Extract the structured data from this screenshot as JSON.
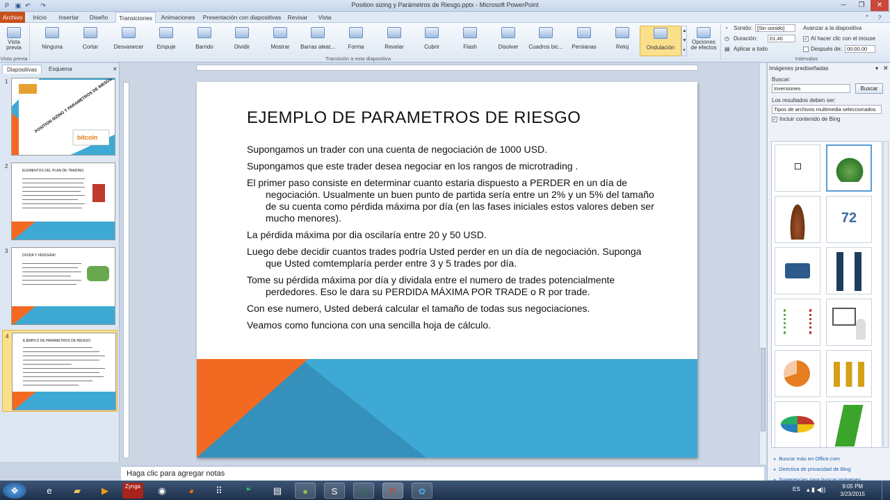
{
  "window": {
    "title": "Position sizing y Parámetros de Riesgo.pptx - Microsoft PowerPoint"
  },
  "tabs": [
    "Archivo",
    "Inicio",
    "Insertar",
    "Diseño",
    "Transiciones",
    "Animaciones",
    "Presentación con diapositivas",
    "Revisar",
    "Vista"
  ],
  "ribbon": {
    "preview_label": "Vista previa",
    "preview_group": "Vista previa",
    "transitions": [
      "Ninguna",
      "Cortar",
      "Desvanecer",
      "Empuje",
      "Barrido",
      "Dividir",
      "Mostrar",
      "Barras aleat...",
      "Forma",
      "Revelar",
      "Cubrir",
      "Flash",
      "Disolver",
      "Cuadros bic...",
      "Persianas",
      "Reloj",
      "Ondulación"
    ],
    "transitions_group": "Transición a esta diapositiva",
    "effect_options": "Opciones de efectos",
    "sound_label": "Sonido:",
    "sound_value": "[Sin sonido]",
    "duration_label": "Duración:",
    "duration_value": "01.40",
    "apply_all": "Aplicar a todo",
    "advance_label": "Avanzar a la diapositiva",
    "on_click": "Al hacer clic con el mouse",
    "after_label": "Después de:",
    "after_value": "00:00.00",
    "timing_group": "Intervalos"
  },
  "panes": {
    "tab_slides": "Diapositivas",
    "tab_outline": "Esquema"
  },
  "thumbnails": [
    {
      "num": "1",
      "title": "POSITION SIZING Y PARAMETROS DE RIESGO",
      "badge": "bitcoin"
    },
    {
      "num": "2",
      "title": "ELEMENTOS DEL PLAN DE TRADING"
    },
    {
      "num": "3",
      "title": "DIVIDA Y VENCERA!"
    },
    {
      "num": "4",
      "title": "EJEMPLO DE PARAMETROS DE RIESGO"
    }
  ],
  "slide": {
    "title": "EJEMPLO DE PARAMETROS DE RIESGO",
    "paragraphs": [
      "Supongamos un trader con una cuenta de negociación de 1000 USD.",
      "Supongamos que este trader desea negociar en los rangos de microtrading .",
      "El primer paso consiste en determinar cuanto estaria dispuesto a PERDER en un día de negociación. Usualmente un buen punto de partida sería entre un 2% y un 5% del tamaño de su cuenta como pérdida máxima por día (en las fases iniciales estos valores deben ser mucho menores).",
      "La pérdida máxima por dia oscilaría entre 20 y 50 USD.",
      "Luego debe decidir cuantos trades podría Usted perder en un día de negociación. Suponga que Usted comtemplaría perder entre 3 y 5 trades por día.",
      "Tome su pérdida máxima por día y dividala entre el numero de trades potencialmente perdedores. Eso le dara su PERDIDA MÁXIMA POR TRADE o R por trade.",
      "Con ese numero, Usted deberá calcular el tamaño de todas sus negociaciones.",
      "Veamos como funciona con una sencilla hoja de cálculo."
    ],
    "colors": {
      "orange": "#f26a21",
      "blue": "#3fa9d5",
      "dark_blue": "#2e7ea6"
    }
  },
  "notes_placeholder": "Haga clic para agregar notas",
  "clipart": {
    "title": "Imágenes prediseñadas",
    "search_label": "Buscar:",
    "search_value": "Inversiones",
    "search_button": "Buscar",
    "results_label": "Los resultados deben ser:",
    "results_value": "Tipos de archivos multimedia seleccionados",
    "include_bing": "Incluir contenido de Bing",
    "items": [
      {
        "label": ""
      },
      {
        "label": ""
      },
      {
        "label": ""
      },
      {
        "label": "72"
      },
      {
        "label": ""
      },
      {
        "label": ""
      },
      {
        "label": ""
      },
      {
        "label": ""
      },
      {
        "label": ""
      },
      {
        "label": ""
      },
      {
        "label": ""
      },
      {
        "label": ""
      }
    ],
    "links": [
      "Buscar más en Office.com",
      "Directiva de privacidad de Bing",
      "Sugerencias para buscar imágenes"
    ]
  },
  "taskbar": {
    "lang": "ES",
    "time": "9:05 PM",
    "date": "3/23/2015",
    "zyoga": "Zynga"
  }
}
